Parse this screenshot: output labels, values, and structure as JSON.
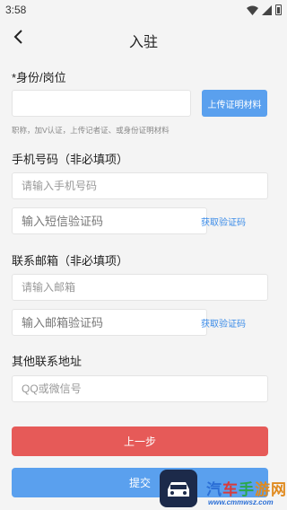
{
  "status_bar": {
    "time": "3:58"
  },
  "nav": {
    "title": "入驻"
  },
  "identity": {
    "label": "*身份/岗位",
    "input_value": "",
    "upload_label": "上传证明材料",
    "hint": "职称，加V认证，上传记者证、或身份证明材料"
  },
  "phone": {
    "label": "手机号码（非必填项）",
    "placeholder": "请输入手机号码",
    "code_placeholder": "输入短信验证码",
    "code_button": "获取验证码"
  },
  "email": {
    "label": "联系邮箱（非必填项）",
    "placeholder": "请输入邮箱",
    "code_placeholder": "输入邮箱验证码",
    "code_button": "获取验证码"
  },
  "other": {
    "label": "其他联系地址",
    "placeholder": "QQ或微信号"
  },
  "buttons": {
    "prev": "上一步",
    "submit": "提交"
  },
  "watermark": {
    "c1": "汽",
    "c2": "车",
    "c3": "手",
    "c4": "游网",
    "url": "www.cmmwsz.com"
  },
  "colors": {
    "accent": "#5aa0ee",
    "danger": "#e65a58",
    "link": "#3a8be8"
  }
}
